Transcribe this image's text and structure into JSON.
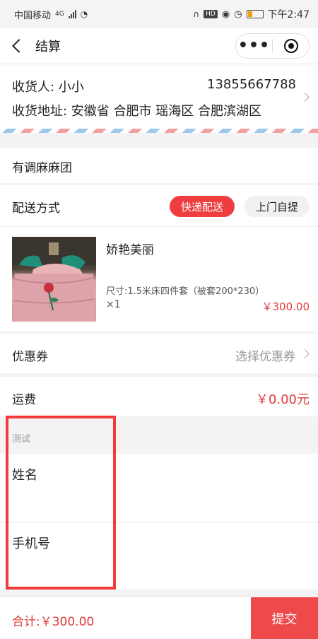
{
  "status_bar": {
    "carrier": "中国移动",
    "network": "4G",
    "time": "下午2:47"
  },
  "nav": {
    "title": "结算",
    "more_label": "•••"
  },
  "address": {
    "receiver": "收货人: 小小",
    "phone": "13855667788",
    "detail": "收货地址: 安徽省 合肥市 瑶海区 合肥滨湖区"
  },
  "shop": {
    "name": "有调麻麻团"
  },
  "delivery": {
    "label": "配送方式",
    "options": [
      "快递配送",
      "上门自提"
    ],
    "selected": "快递配送"
  },
  "product": {
    "name": "娇艳美丽",
    "spec": "尺寸:1.5米床四件套（被套200*230）",
    "quantity": "×1",
    "price": "￥300.00"
  },
  "coupon": {
    "label": "优惠券",
    "action": "选择优惠券"
  },
  "freight": {
    "label": "运费",
    "value": "￥0.00元"
  },
  "test_form": {
    "section_label": "测试",
    "fields": [
      "姓名",
      "手机号"
    ]
  },
  "footer": {
    "total": "合计:￥300.00",
    "submit": "提交"
  },
  "colors": {
    "accent": "#ee3c3f",
    "price": "#e03a3a",
    "highlight": "#f23a3a"
  }
}
